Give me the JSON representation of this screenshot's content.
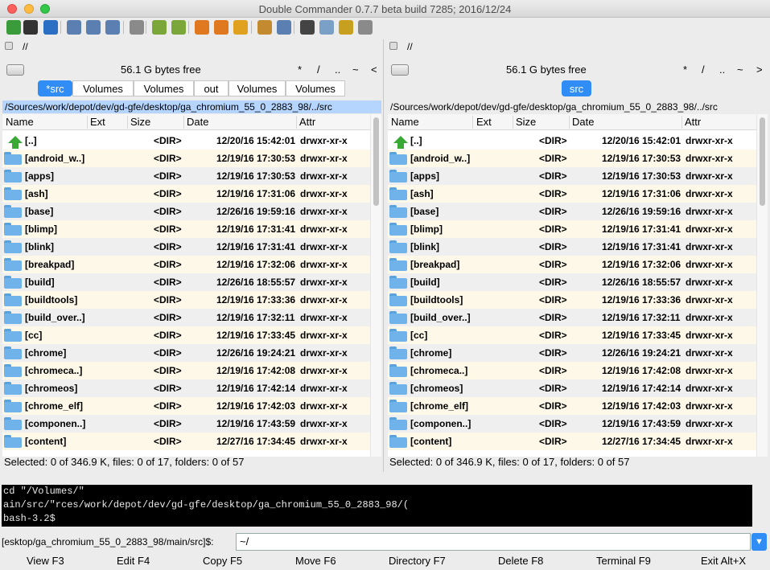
{
  "window": {
    "title": "Double Commander 0.7.7 beta build 7285; 2016/12/24"
  },
  "toolbar": {
    "icons": [
      "refresh-icon",
      "terminal-icon",
      "settings-icon",
      "brief-view-icon",
      "columns-view-icon",
      "thumbnail-view-icon",
      "tree-view-icon",
      "copy-left-icon",
      "copy-right-icon",
      "multi-rename-icon",
      "search-files-icon",
      "sync-dirs-icon",
      "pack-files-icon",
      "unpack-files-icon",
      "binoculars-icon",
      "edit-icon",
      "hotlist-icon",
      "clipboard-icon"
    ]
  },
  "left": {
    "drive": "//",
    "free": "56.1 G bytes free",
    "nav": [
      "*",
      "/",
      "..",
      "~",
      "<"
    ],
    "tabs": [
      "*src",
      "Volumes",
      "Volumes",
      "out",
      "Volumes",
      "Volumes"
    ],
    "path": "/Sources/work/depot/dev/gd-gfe/desktop/ga_chromium_55_0_2883_98/../src",
    "status": "Selected: 0 of 346.9 K, files: 0 of 17, folders: 0 of 57"
  },
  "right": {
    "drive": "//",
    "free": "56.1 G bytes free",
    "nav": [
      "*",
      "/",
      "..",
      "~",
      ">"
    ],
    "tabs": [
      "src"
    ],
    "path": "/Sources/work/depot/dev/gd-gfe/desktop/ga_chromium_55_0_2883_98/../src",
    "status": "Selected: 0 of 346.9 K, files: 0 of 17, folders: 0 of 57"
  },
  "columns": [
    "Name",
    "Ext",
    "Size",
    "Date",
    "Attr"
  ],
  "files": [
    {
      "name": "[..]",
      "size": "<DIR>",
      "date": "12/20/16 15:42:01",
      "attr": "drwxr-xr-x",
      "up": true
    },
    {
      "name": "[android_w..]",
      "size": "<DIR>",
      "date": "12/19/16 17:30:53",
      "attr": "drwxr-xr-x"
    },
    {
      "name": "[apps]",
      "size": "<DIR>",
      "date": "12/19/16 17:30:53",
      "attr": "drwxr-xr-x"
    },
    {
      "name": "[ash]",
      "size": "<DIR>",
      "date": "12/19/16 17:31:06",
      "attr": "drwxr-xr-x"
    },
    {
      "name": "[base]",
      "size": "<DIR>",
      "date": "12/26/16 19:59:16",
      "attr": "drwxr-xr-x"
    },
    {
      "name": "[blimp]",
      "size": "<DIR>",
      "date": "12/19/16 17:31:41",
      "attr": "drwxr-xr-x"
    },
    {
      "name": "[blink]",
      "size": "<DIR>",
      "date": "12/19/16 17:31:41",
      "attr": "drwxr-xr-x"
    },
    {
      "name": "[breakpad]",
      "size": "<DIR>",
      "date": "12/19/16 17:32:06",
      "attr": "drwxr-xr-x"
    },
    {
      "name": "[build]",
      "size": "<DIR>",
      "date": "12/26/16 18:55:57",
      "attr": "drwxr-xr-x"
    },
    {
      "name": "[buildtools]",
      "size": "<DIR>",
      "date": "12/19/16 17:33:36",
      "attr": "drwxr-xr-x"
    },
    {
      "name": "[build_over..]",
      "size": "<DIR>",
      "date": "12/19/16 17:32:11",
      "attr": "drwxr-xr-x"
    },
    {
      "name": "[cc]",
      "size": "<DIR>",
      "date": "12/19/16 17:33:45",
      "attr": "drwxr-xr-x"
    },
    {
      "name": "[chrome]",
      "size": "<DIR>",
      "date": "12/26/16 19:24:21",
      "attr": "drwxr-xr-x"
    },
    {
      "name": "[chromeca..]",
      "size": "<DIR>",
      "date": "12/19/16 17:42:08",
      "attr": "drwxr-xr-x"
    },
    {
      "name": "[chromeos]",
      "size": "<DIR>",
      "date": "12/19/16 17:42:14",
      "attr": "drwxr-xr-x"
    },
    {
      "name": "[chrome_elf]",
      "size": "<DIR>",
      "date": "12/19/16 17:42:03",
      "attr": "drwxr-xr-x"
    },
    {
      "name": "[componen..]",
      "size": "<DIR>",
      "date": "12/19/16 17:43:59",
      "attr": "drwxr-xr-x"
    },
    {
      "name": "[content]",
      "size": "<DIR>",
      "date": "12/27/16 17:34:45",
      "attr": "drwxr-xr-x"
    }
  ],
  "console": {
    "lines": [
      " cd \"/Volumes/\"",
      "ain/src/\"rces/work/depot/dev/gd-gfe/desktop/ga_chromium_55_0_2883_98/(",
      "bash-3.2$"
    ]
  },
  "cmdline": {
    "prompt": "[esktop/ga_chromium_55_0_2883_98/main/src]$:",
    "value": "~/"
  },
  "fkeys": [
    "View F3",
    "Edit F4",
    "Copy F5",
    "Move F6",
    "Directory F7",
    "Delete F8",
    "Terminal F9",
    "Exit Alt+X"
  ]
}
